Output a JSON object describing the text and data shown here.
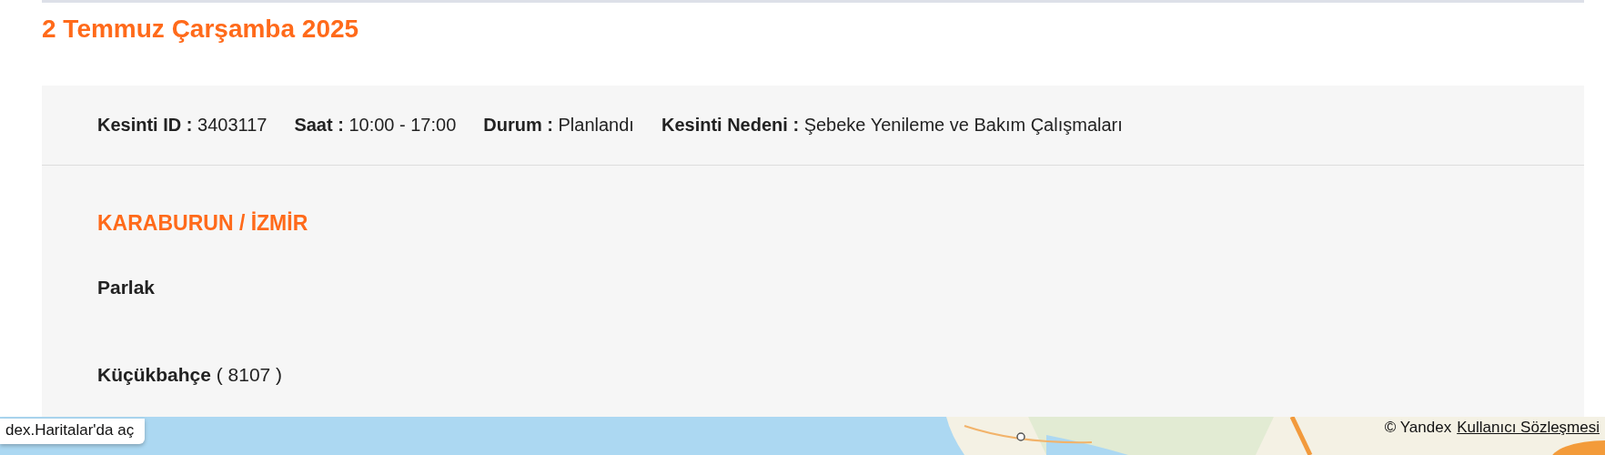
{
  "date_heading": "2 Temmuz Çarşamba 2025",
  "outage": {
    "fields": [
      {
        "label": "Kesinti ID :",
        "value": "3403117"
      },
      {
        "label": "Saat :",
        "value": "10:00 - 17:00"
      },
      {
        "label": "Durum :",
        "value": "Planlandı"
      },
      {
        "label": "Kesinti Nedeni :",
        "value": "Şebeke Yenileme ve Bakım Çalışmaları"
      }
    ],
    "region": "KARABURUN / İZMİR",
    "district": "Parlak",
    "neighborhoods": [
      {
        "name": "Küçükbahçe",
        "detail": "( 8107 )"
      }
    ]
  },
  "map": {
    "open_button": "dex.Haritalar'da aç",
    "copyright": "© Yandex",
    "terms_link": "Kullanıcı Sözleşmesi"
  }
}
